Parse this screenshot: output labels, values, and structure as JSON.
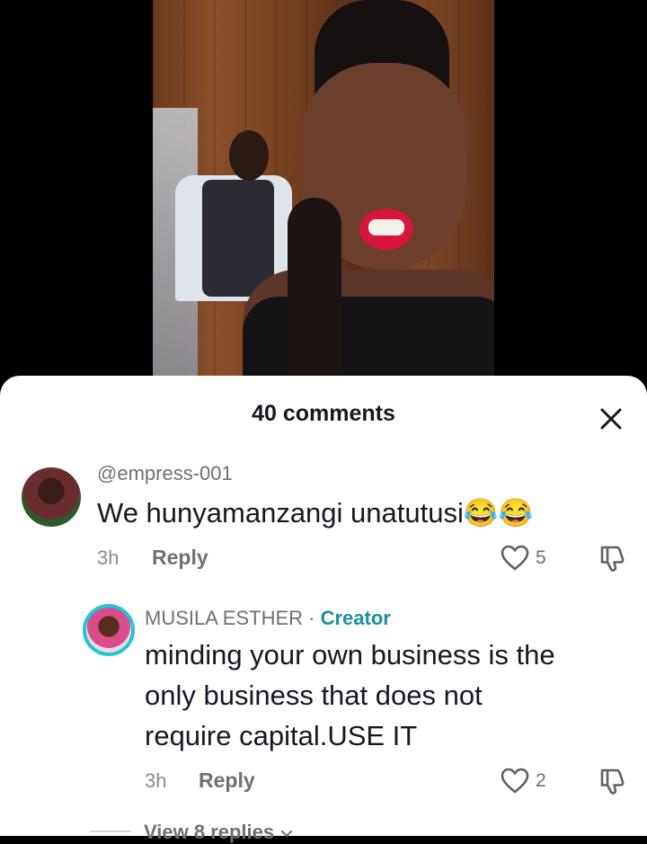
{
  "sheet": {
    "count_label": "40 comments"
  },
  "comments": [
    {
      "username": "@empress-001",
      "text": "We hunyamanzangi unatutusi😂😂",
      "time": "3h",
      "reply_label": "Reply",
      "likes": "5"
    }
  ],
  "reply": {
    "username": "MUSILA ESTHER",
    "separator": " · ",
    "creator_label": "Creator",
    "text_line1": "minding your own business is the",
    "text_line2": "only business that does not",
    "text_line3": "require capital.USE IT",
    "time": "3h",
    "reply_label": "Reply",
    "likes": "2"
  },
  "view_replies_label": "View 8 replies",
  "colors": {
    "accent_creator": "#1d8ea3",
    "avatar_ring": "#20c5d8",
    "text_primary": "#161823",
    "text_secondary": "#6f7076"
  },
  "icons": {
    "close": "close-icon",
    "like": "heart-outline-icon",
    "dislike": "thumbs-down-icon",
    "expand": "chevron-down-icon"
  }
}
